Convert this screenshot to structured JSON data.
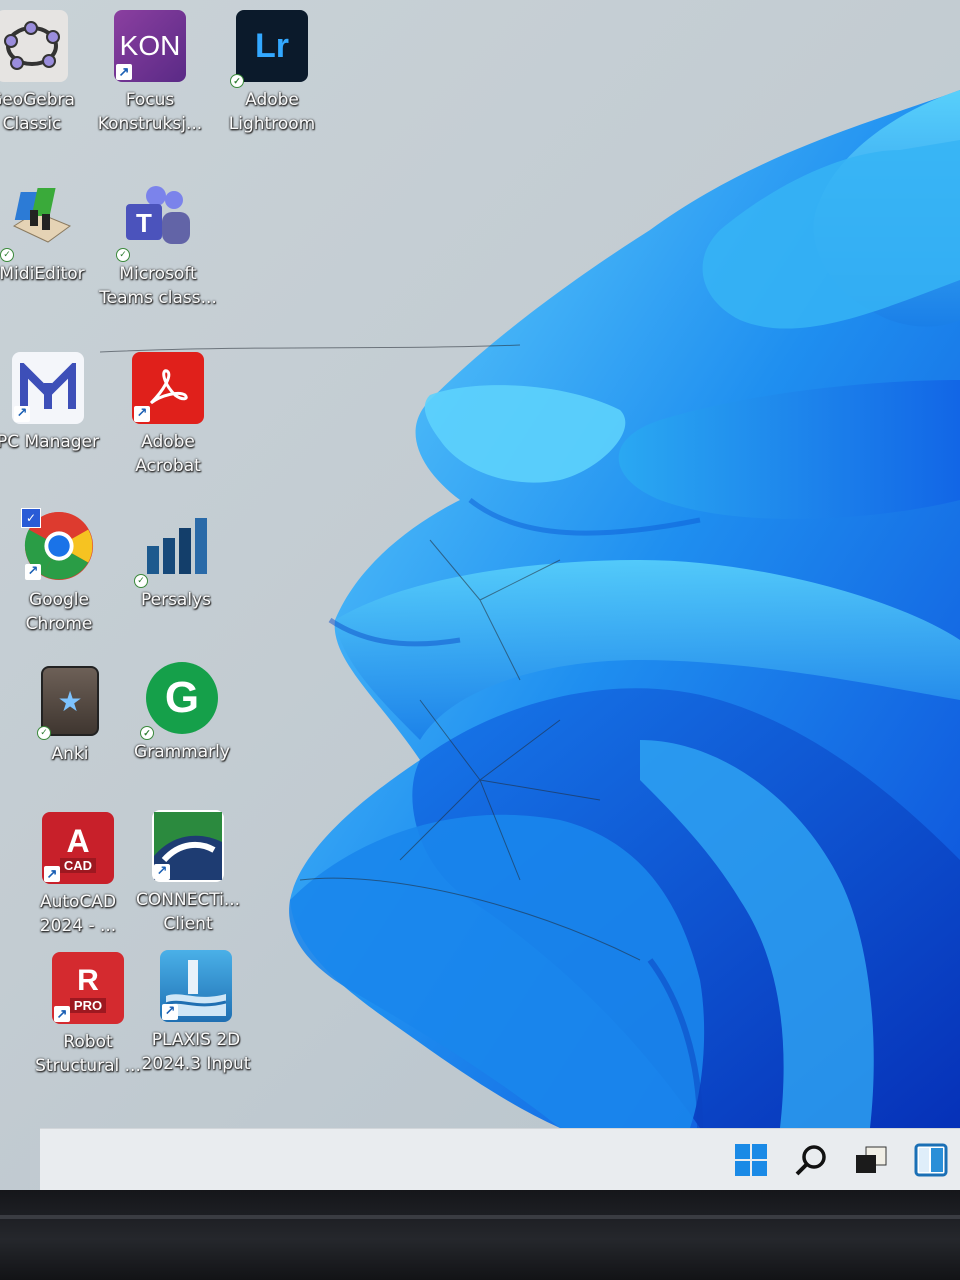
{
  "desktop": {
    "icons": [
      {
        "label": "GeoGebra Classic",
        "icon": "geogebra-icon"
      },
      {
        "label": "Focus Konstruksj...",
        "icon": "focus-kon-icon",
        "tile_text": "KON"
      },
      {
        "label": "Adobe Lightroom",
        "icon": "lightroom-icon",
        "tile_text": "Lr"
      },
      {
        "label": "MidiEditor",
        "icon": "midieditor-icon"
      },
      {
        "label": "Microsoft Teams class...",
        "icon": "teams-icon",
        "tile_text": "T"
      },
      {
        "label": "PC Manager",
        "icon": "pc-manager-icon"
      },
      {
        "label": "Adobe Acrobat",
        "icon": "acrobat-icon"
      },
      {
        "label": "Google Chrome",
        "icon": "chrome-icon"
      },
      {
        "label": "Persalys",
        "icon": "persalys-icon"
      },
      {
        "label": "Anki",
        "icon": "anki-icon"
      },
      {
        "label": "Grammarly",
        "icon": "grammarly-icon",
        "tile_text": "G"
      },
      {
        "label": "AutoCAD 2024 - ...",
        "icon": "autocad-icon",
        "tile_text": "A",
        "tile_sub": "CAD"
      },
      {
        "label": "CONNECTi... Client",
        "icon": "connect-client-icon"
      },
      {
        "label": "Robot Structural ...",
        "icon": "robot-structural-icon",
        "tile_text": "R",
        "tile_sub": "PRO"
      },
      {
        "label": "PLAXIS 2D 2024.3 Input",
        "icon": "plaxis-icon"
      }
    ]
  },
  "taskbar": {
    "buttons": [
      "start-icon",
      "search-icon",
      "task-view-icon",
      "widgets-icon"
    ]
  },
  "colors": {
    "wallpaper_light": "#3fc0f5",
    "wallpaper_dark": "#0a3fd6",
    "taskbar": "#e9ecef"
  }
}
